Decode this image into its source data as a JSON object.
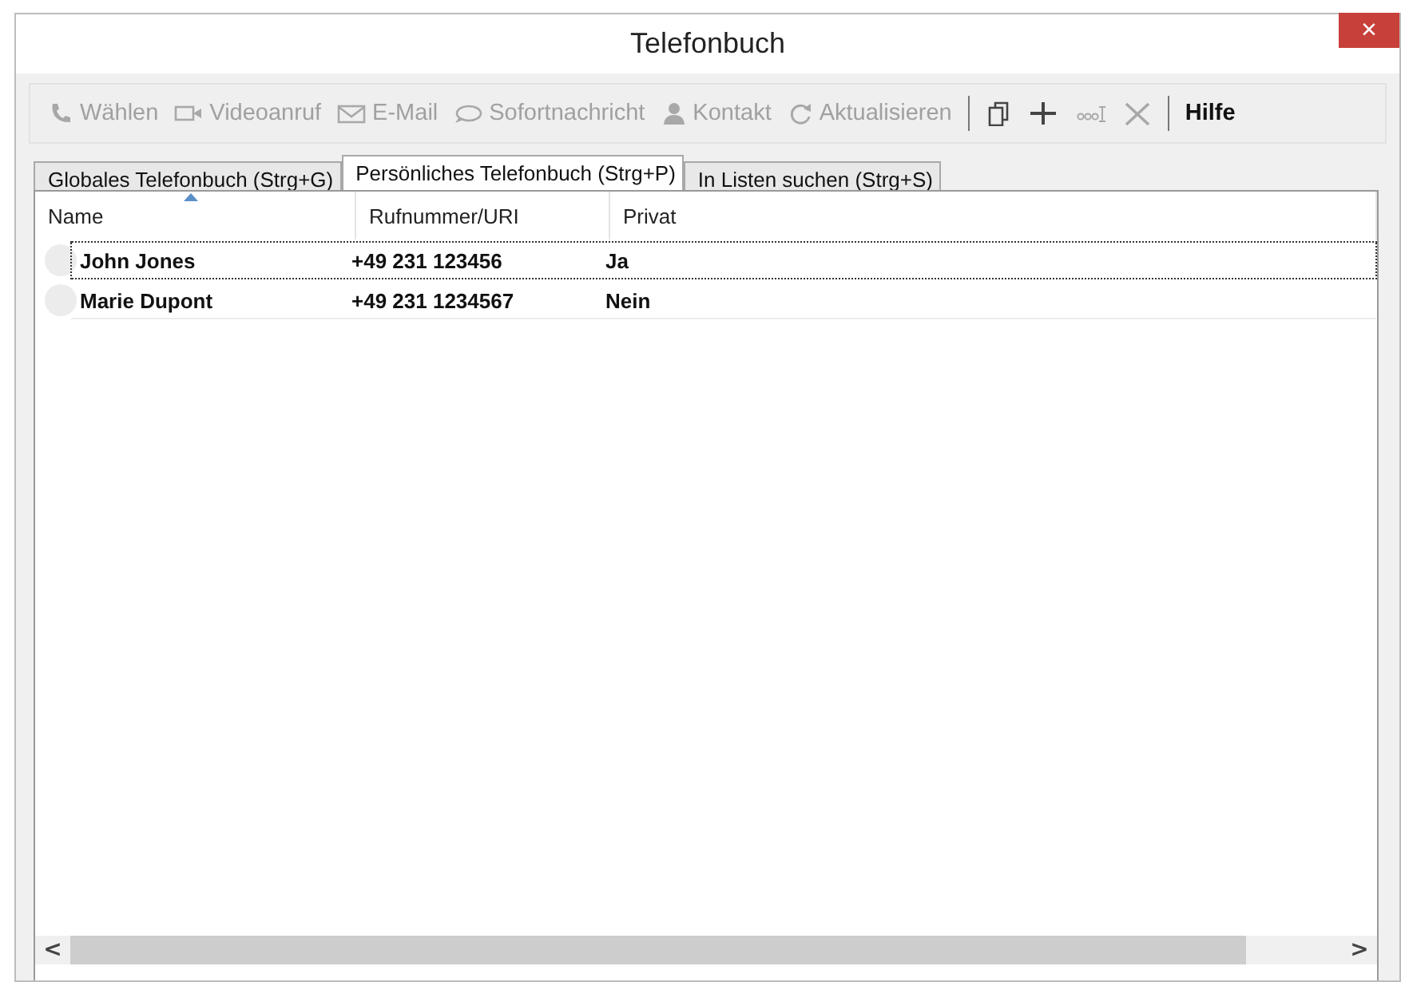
{
  "window": {
    "title": "Telefonbuch",
    "close": "×"
  },
  "toolbar": [
    {
      "kind": "phone",
      "label": "Wählen",
      "disabled": true
    },
    {
      "kind": "video",
      "label": "Videoanruf",
      "disabled": true
    },
    {
      "kind": "mail",
      "label": "E-Mail",
      "disabled": true
    },
    {
      "kind": "chat",
      "label": "Sofortnachricht",
      "disabled": true
    },
    {
      "kind": "person",
      "label": "Kontakt",
      "disabled": true
    },
    {
      "kind": "refresh",
      "label": "Aktualisieren",
      "disabled": true
    },
    {
      "kind": "separator"
    },
    {
      "kind": "copy",
      "disabled": false
    },
    {
      "kind": "add",
      "disabled": false
    },
    {
      "kind": "rename",
      "disabled": true
    },
    {
      "kind": "delete",
      "disabled": true
    },
    {
      "kind": "separator"
    },
    {
      "kind": "text",
      "label": "Hilfe",
      "disabled": false
    }
  ],
  "tabs": [
    {
      "label": "Globales Telefonbuch  (Strg+G)",
      "selected": false
    },
    {
      "label": "Persönliches Telefonbuch  (Strg+P)",
      "selected": true
    },
    {
      "label": "In Listen suchen (Strg+S)",
      "selected": false
    }
  ],
  "table": {
    "columns": [
      {
        "label": "Name",
        "sorted": true
      },
      {
        "label": "Rufnummer/URI",
        "sorted": false
      },
      {
        "label": "Privat",
        "sorted": false
      }
    ],
    "rows": [
      {
        "name": "John Jones",
        "number": "+49 231 123456",
        "private": "Ja",
        "selected": true
      },
      {
        "name": "Marie Dupont",
        "number": "+49 231 1234567",
        "private": "Nein",
        "selected": false
      }
    ]
  },
  "scrollbar": {
    "left": "<",
    "right": ">"
  }
}
